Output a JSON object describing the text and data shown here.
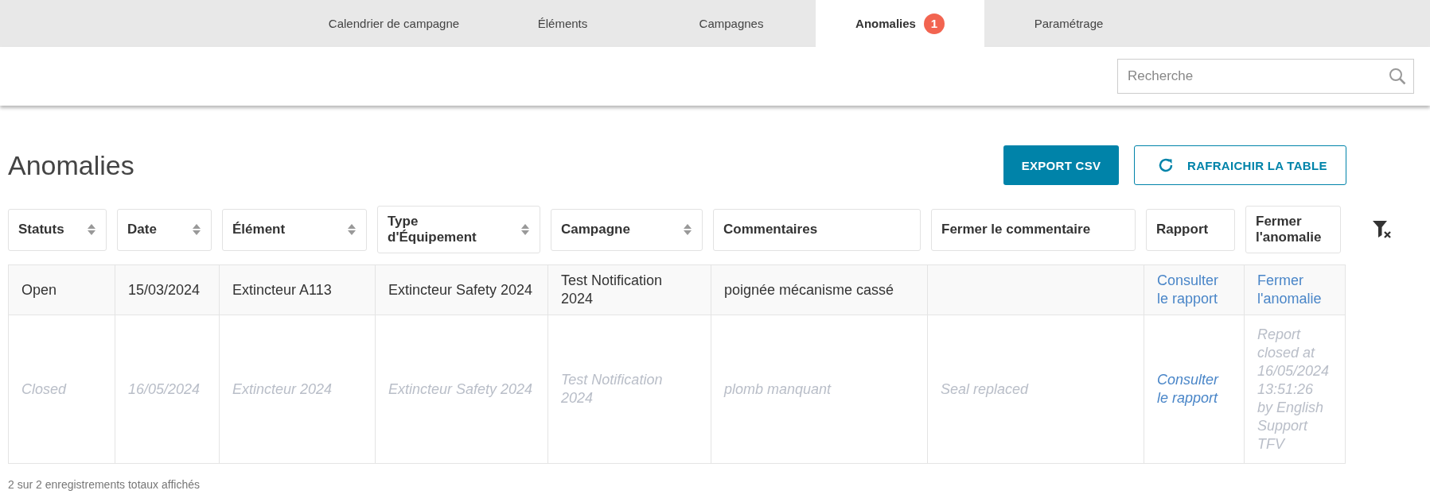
{
  "nav": {
    "tabs": [
      {
        "label": "Calendrier de campagne",
        "selected": false
      },
      {
        "label": "Éléments",
        "selected": false
      },
      {
        "label": "Campagnes",
        "selected": false
      },
      {
        "label": "Anomalies",
        "selected": true,
        "badge": "1"
      },
      {
        "label": "Paramétrage",
        "selected": false
      }
    ]
  },
  "search": {
    "placeholder": "Recherche"
  },
  "page": {
    "title": "Anomalies",
    "buttons": [
      {
        "kind": "primary",
        "label": "EXPORT CSV"
      },
      {
        "kind": "refresh",
        "label": "RAFRAICHIR LA TABLE"
      }
    ]
  },
  "table": {
    "columns": [
      {
        "label": "Statuts",
        "sortable": true
      },
      {
        "label": "Date",
        "sortable": true
      },
      {
        "label": "Élément",
        "sortable": true
      },
      {
        "label": "Type d'Équipement",
        "sortable": true
      },
      {
        "label": "Campagne",
        "sortable": true
      },
      {
        "label": "Commentaires",
        "sortable": false
      },
      {
        "label": "Fermer le commentaire",
        "sortable": false
      },
      {
        "label": "Rapport",
        "sortable": false
      },
      {
        "label": "Fermer l'anomalie",
        "sortable": false
      }
    ],
    "rows": [
      {
        "closed": false,
        "cells": [
          "Open",
          "15/03/2024",
          "Extincteur A113",
          "Extincteur Safety 2024",
          "Test Notification 2024",
          "poignée mécanisme cassé",
          "",
          "Consulter le rapport",
          "Fermer l'anomalie"
        ]
      },
      {
        "closed": true,
        "cells": [
          "Closed",
          "16/05/2024",
          "Extincteur 2024",
          "Extincteur Safety 2024",
          "Test Notification 2024",
          "plomb manquant",
          "Seal replaced",
          "Consulter le rapport",
          "Report closed at 16/05/2024 13:51:26 by English Support TFV"
        ]
      }
    ],
    "footer": "2 sur 2 enregistrements totaux affichés"
  }
}
